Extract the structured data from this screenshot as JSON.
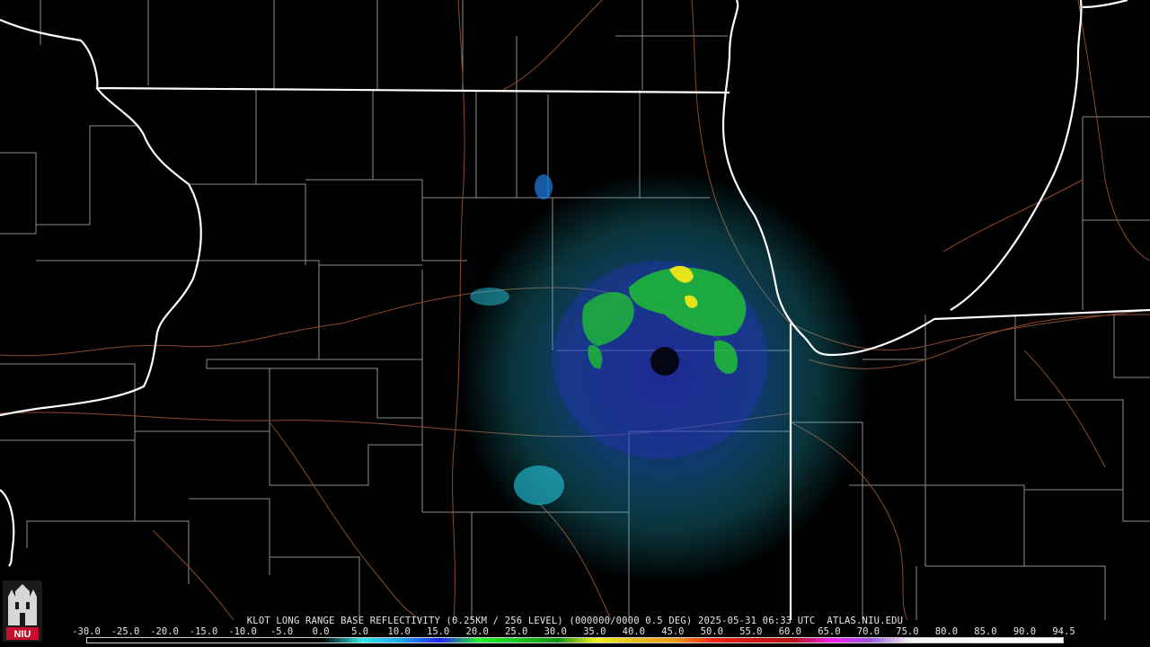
{
  "product": {
    "title": "KLOT LONG RANGE BASE REFLECTIVITY (0.25KM / 256 LEVEL) (000000/0000 0.5 DEG) 2025-05-31 06:33 UTC  ATLAS.NIU.EDU",
    "radar_site": "KLOT",
    "timestamp": "2025-05-31 06:33 UTC",
    "source": "ATLAS.NIU.EDU"
  },
  "logo": {
    "text": "NIU",
    "icon": "niu-castle-logo"
  },
  "color_scale": {
    "labels": [
      "-30.0",
      "-25.0",
      "-20.0",
      "-15.0",
      "-10.0",
      "-5.0",
      "0.0",
      "5.0",
      "10.0",
      "15.0",
      "20.0",
      "25.0",
      "30.0",
      "35.0",
      "40.0",
      "45.0",
      "50.0",
      "55.0",
      "60.0",
      "65.0",
      "70.0",
      "75.0",
      "80.0",
      "85.0",
      "90.0",
      "94.5"
    ],
    "min": -30.0,
    "max": 94.5,
    "stops": [
      {
        "value": -30,
        "color": "#000000"
      },
      {
        "value": 0,
        "color": "#000000"
      },
      {
        "value": 5,
        "color": "#2fe7e8"
      },
      {
        "value": 10,
        "color": "#1aa6f0"
      },
      {
        "value": 15,
        "color": "#2323f4"
      },
      {
        "value": 20,
        "color": "#1fef2b"
      },
      {
        "value": 25,
        "color": "#17c61c"
      },
      {
        "value": 30,
        "color": "#0f9112"
      },
      {
        "value": 35,
        "color": "#f2f21b"
      },
      {
        "value": 40,
        "color": "#e5bc18"
      },
      {
        "value": 45,
        "color": "#f29a17"
      },
      {
        "value": 50,
        "color": "#f22216"
      },
      {
        "value": 55,
        "color": "#cc1713"
      },
      {
        "value": 60,
        "color": "#b50f10"
      },
      {
        "value": 65,
        "color": "#f21ff2"
      },
      {
        "value": 70,
        "color": "#9a5ad8"
      },
      {
        "value": 75,
        "color": "#f5f5f5"
      },
      {
        "value": 94.5,
        "color": "#ffffff"
      }
    ]
  },
  "colors": {
    "background": "#000000",
    "state_border": "#ffffff",
    "county_border": "#8c8c8c",
    "highway": "#8b4a2b"
  }
}
